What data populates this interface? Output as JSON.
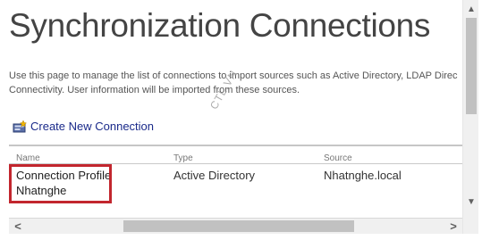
{
  "page": {
    "title": "Synchronization Connections",
    "description_line1": "Use this page to manage the list of connections to import sources such as Active Directory, LDAP Direc",
    "description_line2": "Connectivity. User information will be imported from these sources."
  },
  "watermark": "CTL.VN",
  "actions": {
    "create_label": "Create New Connection",
    "create_icon": "new-connection-icon"
  },
  "table": {
    "columns": [
      "Name",
      "Type",
      "Source"
    ],
    "rows": [
      {
        "name_line1": "Connection Profile",
        "name_line2": "Nhatnghe",
        "type": "Active Directory",
        "source": "Nhatnghe.local"
      }
    ]
  },
  "scrollbars": {
    "left_arrow": "<",
    "right_arrow": ">",
    "up_arrow": "▲",
    "down_arrow": "▼"
  },
  "colors": {
    "highlight": "#c2262e",
    "link": "#1a2a8a",
    "title": "#444444"
  }
}
